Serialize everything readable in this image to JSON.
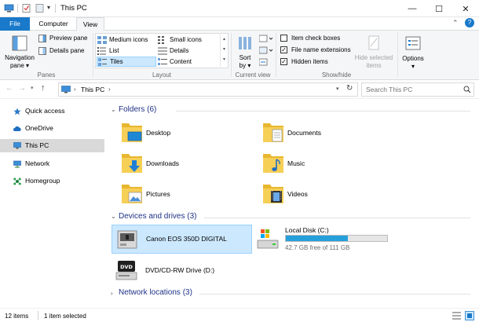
{
  "window": {
    "title": "This PC",
    "controls": {
      "minimize": "—",
      "maximize": "☐",
      "close": "✕"
    },
    "help": "?"
  },
  "ribbon_tabs": {
    "file": "File",
    "computer": "Computer",
    "view": "View"
  },
  "ribbon": {
    "panes": {
      "navigation_pane_line1": "Navigation",
      "navigation_pane_line2": "pane ▾",
      "preview_pane": "Preview pane",
      "details_pane": "Details pane",
      "group_label": "Panes"
    },
    "layout": {
      "medium_icons": "Medium icons",
      "small_icons": "Small icons",
      "list": "List",
      "details": "Details",
      "tiles": "Tiles",
      "content": "Content",
      "group_label": "Layout"
    },
    "current_view": {
      "sort_by_line1": "Sort",
      "sort_by_line2": "by ▾",
      "group_label": "Current view"
    },
    "show_hide": {
      "item_check_boxes": {
        "label": "Item check boxes",
        "checked": false
      },
      "file_name_extensions": {
        "label": "File name extensions",
        "checked": true
      },
      "hidden_items": {
        "label": "Hidden items",
        "checked": true
      },
      "hide_selected_line1": "Hide selected",
      "hide_selected_line2": "items",
      "group_label": "Show/hide"
    },
    "options": {
      "label": "Options",
      "arrow": "▾"
    }
  },
  "addressbar": {
    "path": "This PC",
    "search_placeholder": "Search This PC"
  },
  "navpane": {
    "items": [
      {
        "label": "Quick access",
        "icon": "star-icon"
      },
      {
        "label": "OneDrive",
        "icon": "cloud-icon"
      },
      {
        "label": "This PC",
        "icon": "computer-icon",
        "selected": true
      },
      {
        "label": "Network",
        "icon": "network-icon"
      },
      {
        "label": "Homegroup",
        "icon": "homegroup-icon"
      }
    ]
  },
  "sections": {
    "folders": {
      "title": "Folders (6)",
      "items": [
        "Desktop",
        "Documents",
        "Downloads",
        "Music",
        "Pictures",
        "Videos"
      ]
    },
    "devices": {
      "title": "Devices and drives (3)",
      "camera": "Canon EOS 350D DIGITAL",
      "local_disk": {
        "name": "Local Disk (C:)",
        "free_text": "42.7 GB free of 111 GB",
        "used_fraction": 0.615
      },
      "dvd": "DVD/CD-RW Drive (D:)"
    },
    "network": {
      "title": "Network locations (3)"
    }
  },
  "statusbar": {
    "item_count": "12 items",
    "selected": "1 item selected"
  },
  "colors": {
    "accent": "#1979ca",
    "selection": "#cce8ff",
    "selection_border": "#99d1ff",
    "nav_selected": "#d9d9d9",
    "disk_bar": "#26a0da",
    "folder_yellow": "#f6cf57"
  }
}
